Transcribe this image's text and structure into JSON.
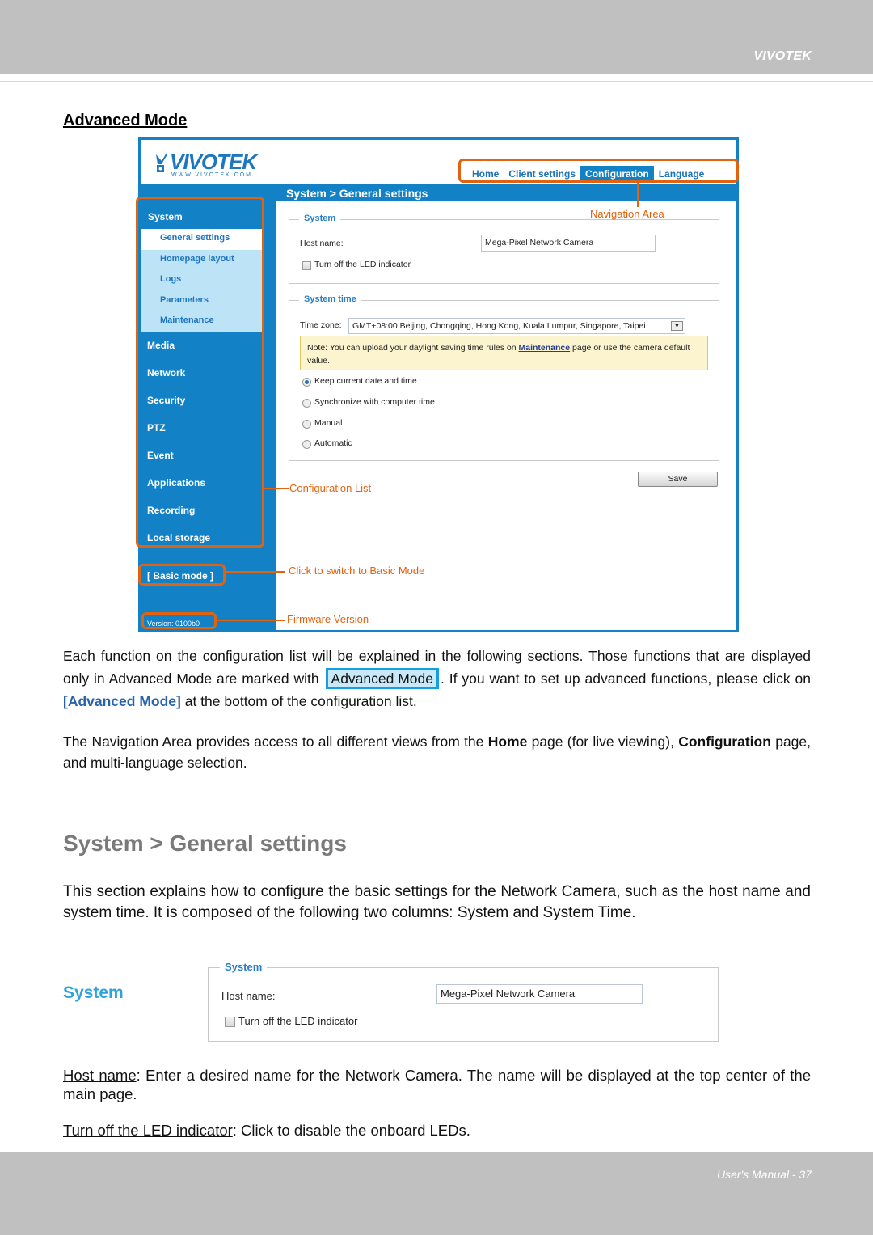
{
  "header": {
    "brand": "VIVOTEK"
  },
  "footer": {
    "page_label": "User's Manual - 37"
  },
  "section_heading": "Advanced Mode",
  "screenshot": {
    "logo_text": "VIVOTEK",
    "logo_url_text": "WWW.VIVOTEK.COM",
    "nav": [
      {
        "label": "Home",
        "active": false
      },
      {
        "label": "Client settings",
        "active": false
      },
      {
        "label": "Configuration",
        "active": true
      },
      {
        "label": "Language",
        "active": false
      }
    ],
    "breadcrumb": "System  > General settings",
    "sidebar": {
      "group": "System",
      "subitems": [
        {
          "label": "General settings",
          "selected": true
        },
        {
          "label": "Homepage layout",
          "selected": false
        },
        {
          "label": "Logs",
          "selected": false
        },
        {
          "label": "Parameters",
          "selected": false
        },
        {
          "label": "Maintenance",
          "selected": false
        }
      ],
      "items": [
        "Media",
        "Network",
        "Security",
        "PTZ",
        "Event",
        "Applications",
        "Recording",
        "Local storage"
      ],
      "basic_mode": "[ Basic mode ]",
      "version": "Version: 0100b0"
    },
    "system_fieldset": {
      "legend": "System",
      "host_label": "Host name:",
      "host_value": "Mega-Pixel Network Camera",
      "led_label": "Turn off the LED indicator",
      "led_checked": false
    },
    "time_fieldset": {
      "legend": "System time",
      "tz_label": "Time zone:",
      "tz_value": "GMT+08:00 Beijing, Chongqing, Hong Kong, Kuala Lumpur, Singapore, Taipei",
      "note_prefix": "Note: You can upload your daylight saving time rules on ",
      "note_link": "Maintenance",
      "note_suffix": " page or use the camera default value.",
      "options": [
        {
          "label": "Keep current date and time",
          "selected": true
        },
        {
          "label": "Synchronize with computer time",
          "selected": false
        },
        {
          "label": "Manual",
          "selected": false
        },
        {
          "label": "Automatic",
          "selected": false
        }
      ]
    },
    "save_label": "Save",
    "annotations": {
      "navigation_area": "Navigation Area",
      "configuration_list": "Configuration List",
      "basic_mode": "Click to switch to Basic Mode",
      "firmware": "Firmware Version"
    }
  },
  "para1": {
    "text_a": "Each function on the configuration list will be explained in the following sections. Those functions that are displayed only in Advanced Mode are marked with",
    "badge": "Advanced Mode",
    "text_b": ". If you want to set up advanced functions, please click on ",
    "link": "[Advanced Mode]",
    "text_c": " at the bottom of the configuration list."
  },
  "para2": {
    "text_a": "The Navigation Area provides access to all different views from the ",
    "bold_a": "Home",
    "text_b": " page (for live viewing), ",
    "bold_b": "Configuration",
    "text_c": " page, and multi-language selection."
  },
  "section2_title": "System > General settings",
  "para3": "This section explains how to configure the basic settings for the Network Camera, such as the host name and system time. It is composed of the following two columns: System and System Time.",
  "system_heading": "System",
  "system_panel": {
    "legend": "System",
    "host_label": "Host name:",
    "host_value": "Mega-Pixel Network Camera",
    "led_label": "Turn off the LED indicator"
  },
  "desc_host": {
    "term": "Host name",
    "text": ": Enter a desired name for the Network Camera. The name will be displayed at the top center of the main page."
  },
  "desc_led": {
    "term": "Turn off the LED indicator",
    "text": ": Click to disable the onboard LEDs."
  }
}
